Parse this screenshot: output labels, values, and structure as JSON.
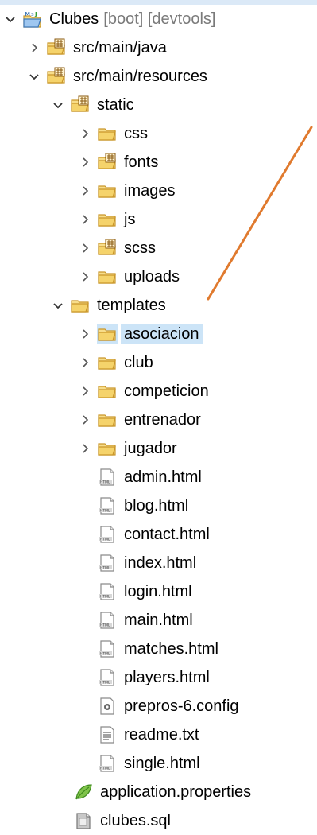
{
  "tree": {
    "project": {
      "label": "Clubes",
      "decorations": "[boot] [devtools]"
    },
    "items": [
      {
        "label": "src/main/java"
      },
      {
        "label": "src/main/resources"
      },
      {
        "label": "static"
      },
      {
        "label": "css"
      },
      {
        "label": "fonts"
      },
      {
        "label": "images"
      },
      {
        "label": "js"
      },
      {
        "label": "scss"
      },
      {
        "label": "uploads"
      },
      {
        "label": "templates"
      },
      {
        "label": "asociacion"
      },
      {
        "label": "club"
      },
      {
        "label": "competicion"
      },
      {
        "label": "entrenador"
      },
      {
        "label": "jugador"
      },
      {
        "label": "admin.html"
      },
      {
        "label": "blog.html"
      },
      {
        "label": "contact.html"
      },
      {
        "label": "index.html"
      },
      {
        "label": "login.html"
      },
      {
        "label": "main.html"
      },
      {
        "label": "matches.html"
      },
      {
        "label": "players.html"
      },
      {
        "label": "prepros-6.config"
      },
      {
        "label": "readme.txt"
      },
      {
        "label": "single.html"
      },
      {
        "label": "application.properties"
      },
      {
        "label": "clubes.sql"
      }
    ],
    "selected": "asociacion"
  },
  "icons": {
    "project": "spring-project-icon",
    "source-folder": "package-folder-icon",
    "folder": "folder-icon",
    "html-file": "html-file-icon",
    "config-file": "gear-file-icon",
    "text-file": "text-file-icon",
    "properties-file": "spring-leaf-icon",
    "sql-file": "sql-file-icon"
  },
  "colors": {
    "selection": "#cce4f7",
    "folder": "#f5d36b",
    "arrow": "#e07a2e",
    "decoration_text": "#7a7a7a"
  }
}
